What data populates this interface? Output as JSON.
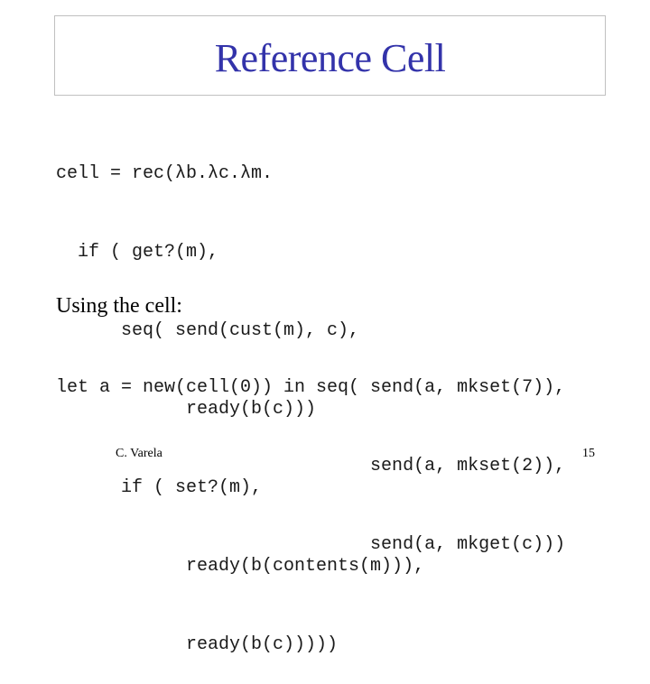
{
  "slide": {
    "title": "Reference Cell",
    "code_block_1": [
      "cell = rec(λb.λc.λm.",
      "  if ( get?(m),",
      "      seq( send(cust(m), c),",
      "            ready(b(c)))",
      "      if ( set?(m),",
      "            ready(b(contents(m))),",
      "            ready(b(c)))))"
    ],
    "subheading": "Using the cell:",
    "code_block_2": [
      "let a = new(cell(0)) in seq( send(a, mkset(7)),",
      "                             send(a, mkset(2)),",
      "                             send(a, mkget(c)))"
    ],
    "footer": {
      "author": "C. Varela",
      "page_number": "15"
    }
  },
  "colors": {
    "title": "#3333aa",
    "title_border": "#c0c0c0",
    "text": "#000000"
  }
}
